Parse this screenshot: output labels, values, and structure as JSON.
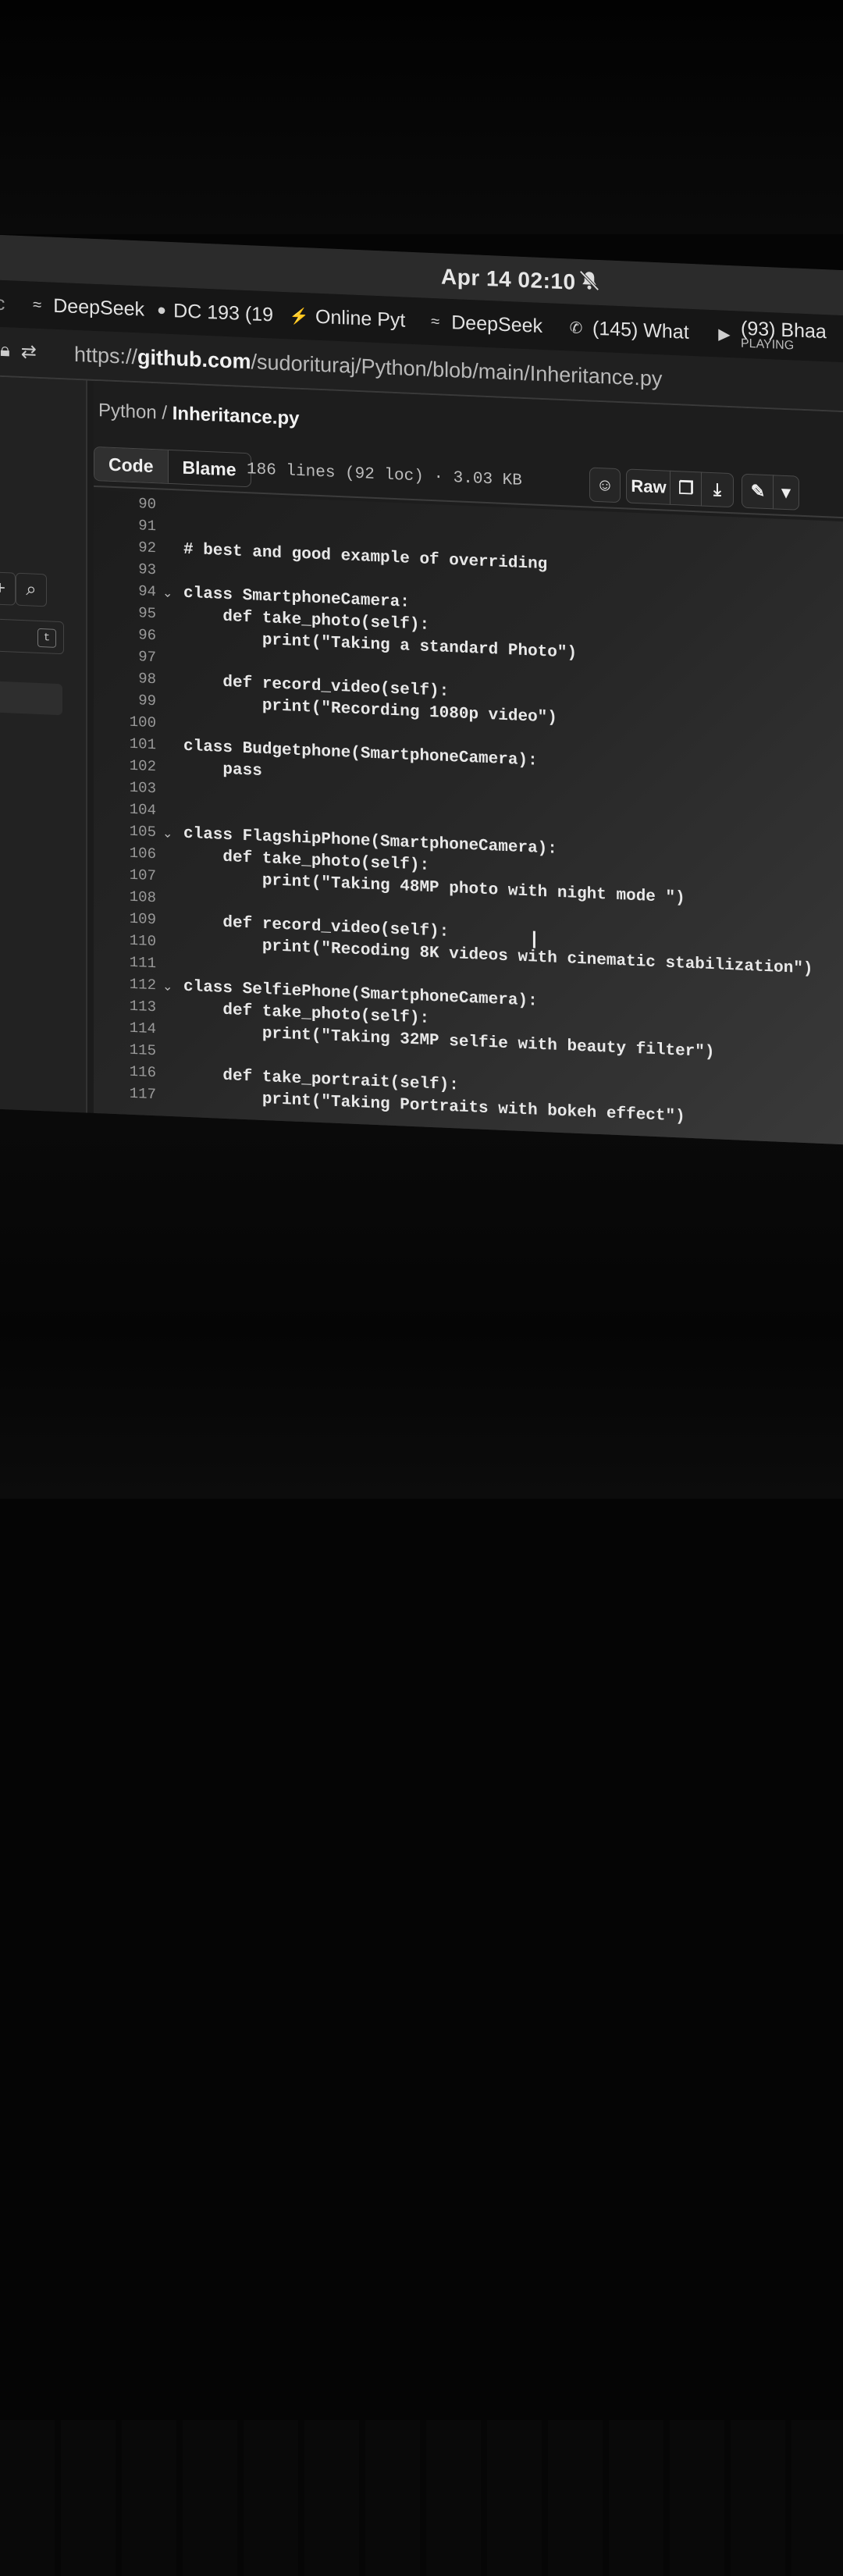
{
  "system": {
    "clock": "Apr 14  02:10"
  },
  "tabs": [
    {
      "label": "nc",
      "icon": "page-icon"
    },
    {
      "label": "DeepSeek",
      "icon": "deepseek-icon"
    },
    {
      "label": "DC 193 (19",
      "icon": "circle-icon"
    },
    {
      "label": "Online Pyt",
      "icon": "bolt-icon"
    },
    {
      "label": "DeepSeek",
      "icon": "deepseek-icon"
    },
    {
      "label": "(145) What",
      "icon": "whatsapp-icon"
    },
    {
      "label": "(93) Bhaa",
      "sub": "PLAYING",
      "icon": "youtube-icon"
    }
  ],
  "address": {
    "prefix": "https://",
    "host": "github.com",
    "path": "/sudorituraj/Python/blob/main/Inheritance.py"
  },
  "breadcrumb": {
    "repo": "Python",
    "sep": " / ",
    "file": "Inheritance.py"
  },
  "toolbar": {
    "code_label": "Code",
    "blame_label": "Blame",
    "file_info": "186 lines (92 loc) · 3.03 KB",
    "raw_label": "Raw"
  },
  "sidebar": {
    "search_key": "t"
  },
  "code_lines": [
    {
      "n": "90",
      "t": ""
    },
    {
      "n": "91",
      "t": ""
    },
    {
      "n": "92",
      "t": "# best and good example of overriding"
    },
    {
      "n": "93",
      "t": ""
    },
    {
      "n": "94",
      "t": "class SmartphoneCamera:",
      "fold": true
    },
    {
      "n": "95",
      "t": "    def take_photo(self):"
    },
    {
      "n": "96",
      "t": "        print(\"Taking a standard Photo\")"
    },
    {
      "n": "97",
      "t": ""
    },
    {
      "n": "98",
      "t": "    def record_video(self):"
    },
    {
      "n": "99",
      "t": "        print(\"Recording 1080p video\")"
    },
    {
      "n": "100",
      "t": ""
    },
    {
      "n": "101",
      "t": "class Budgetphone(SmartphoneCamera):"
    },
    {
      "n": "102",
      "t": "    pass"
    },
    {
      "n": "103",
      "t": ""
    },
    {
      "n": "104",
      "t": ""
    },
    {
      "n": "105",
      "t": "class FlagshipPhone(SmartphoneCamera):",
      "fold": true
    },
    {
      "n": "106",
      "t": "    def take_photo(self):"
    },
    {
      "n": "107",
      "t": "        print(\"Taking 48MP photo with night mode \")"
    },
    {
      "n": "108",
      "t": ""
    },
    {
      "n": "109",
      "t": "    def record_video(self):"
    },
    {
      "n": "110",
      "t": "        print(\"Recoding 8K videos with cinematic stabilization\")"
    },
    {
      "n": "111",
      "t": ""
    },
    {
      "n": "112",
      "t": "class SelfiePhone(SmartphoneCamera):",
      "fold": true
    },
    {
      "n": "113",
      "t": "    def take_photo(self):"
    },
    {
      "n": "114",
      "t": "        print(\"Taking 32MP selfie with beauty filter\")"
    },
    {
      "n": "115",
      "t": ""
    },
    {
      "n": "116",
      "t": "    def take_portrait(self):"
    },
    {
      "n": "117",
      "t": "        print(\"Taking Portraits with bokeh effect\")"
    }
  ]
}
